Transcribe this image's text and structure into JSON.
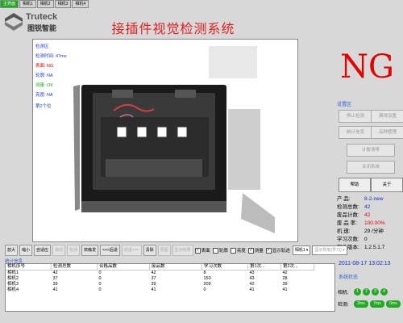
{
  "tabs": [
    "主界面",
    "相机1",
    "相机2",
    "相机3",
    "相机4"
  ],
  "logo": {
    "name": "Truteck",
    "sub": "图锐智能"
  },
  "title": "接插件视觉检测系统",
  "overlay": {
    "area": "检测区",
    "time": "检测时间: 47ms",
    "surface": "表面: NG",
    "contour": "轮廓: NA",
    "measure": "测量: OK",
    "brightness": "亮度: NA",
    "station": "第2个位"
  },
  "result": "NG",
  "settings": {
    "label": "设置区",
    "buttons": [
      "停止检测",
      "离线设置",
      "统计信息",
      "品种管理",
      "计数清零",
      "关闭系统"
    ],
    "help": "帮助",
    "about": "关于"
  },
  "info": [
    {
      "k": "产 品:",
      "v": "8-2-new",
      "color": "#1030c0"
    },
    {
      "k": "检测总数:",
      "v": "42",
      "color": "#1030c0"
    },
    {
      "k": "废品计数:",
      "v": "42",
      "color": "#e00000"
    },
    {
      "k": "废 品 率:",
      "v": "100.00%",
      "color": "#e00000"
    },
    {
      "k": "机  速:",
      "v": "29 /分钟",
      "color": "#000000"
    },
    {
      "k": "学习次数:",
      "v": "0",
      "color": "#000000"
    },
    {
      "k": "软件版本:",
      "v": "1.2.5.1.7",
      "color": "#000000"
    }
  ],
  "datetime": "2011-08-17 13:02:13",
  "system_status": {
    "label": "系统状态",
    "camera_label": "相机:",
    "detect_label": "检测:",
    "cams": [
      "1",
      "2",
      "3",
      "4"
    ],
    "detect": [
      "2ms",
      "7ms",
      "0ms",
      "0ms"
    ]
  },
  "toolbar": {
    "buttons": [
      "放大",
      "缩小",
      "自适应",
      "滚动",
      "检测",
      "软触发",
      "<<<后退",
      "前进>>>",
      "清除",
      "原图",
      "显示结果"
    ],
    "checks": [
      "表面",
      "轮廓",
      "亮度",
      "测量",
      "显示轨迹"
    ],
    "camera_select": "相机1",
    "mode_select": "显示所有(学习)"
  },
  "stats": {
    "title": "统计信息",
    "headers": [
      "相机序号",
      "检测总数",
      "合格品数",
      "废品数",
      "学习次数",
      "第1次...",
      "第2次..."
    ],
    "rows": [
      [
        "相机1",
        "42",
        "0",
        "42",
        "8",
        "43",
        "42"
      ],
      [
        "相机2",
        "37",
        "0",
        "37",
        "150",
        "43",
        "28"
      ],
      [
        "相机3",
        "39",
        "0",
        "39",
        "209",
        "42",
        "39"
      ],
      [
        "相机4",
        "41",
        "0",
        "41",
        "0",
        "41",
        "41"
      ]
    ]
  }
}
